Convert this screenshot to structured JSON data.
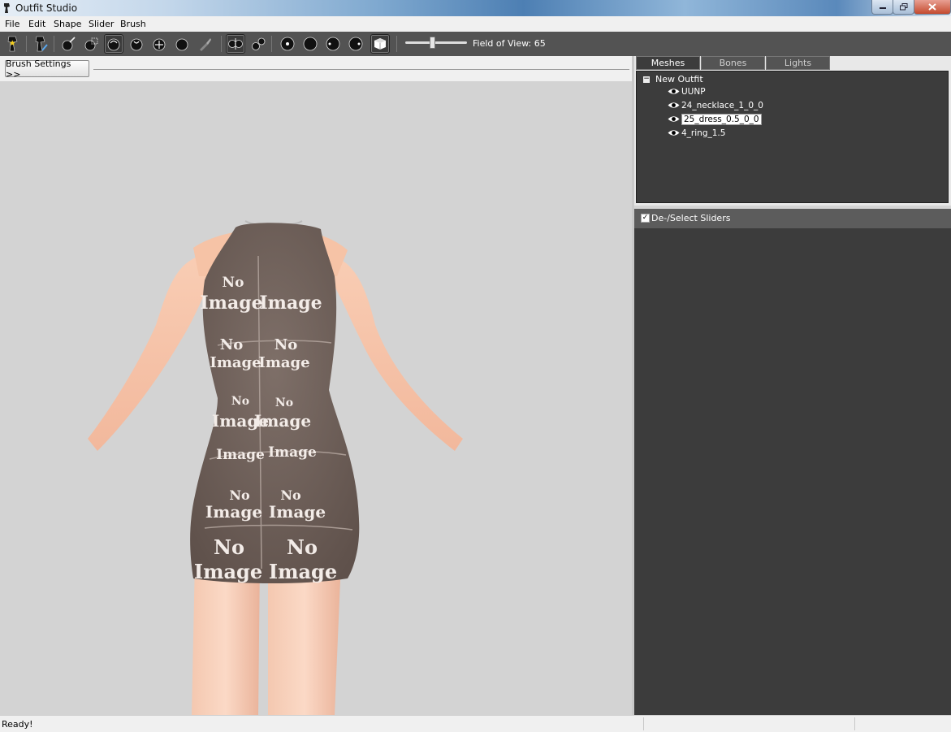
{
  "window": {
    "title": "Outfit Studio"
  },
  "menu": [
    "File",
    "Edit",
    "Shape",
    "Slider",
    "Brush"
  ],
  "toolbar": {
    "fov_label": "Field of View: 65",
    "fov_value": 65
  },
  "brush_settings": {
    "label": "Brush Settings >>"
  },
  "tabs": [
    {
      "label": "Meshes",
      "active": true
    },
    {
      "label": "Bones",
      "active": false
    },
    {
      "label": "Lights",
      "active": false
    }
  ],
  "mesh_tree": {
    "root": "New Outfit",
    "items": [
      "UUNP",
      "24_necklace_1_0_0",
      "25_dress_0.5_0_0",
      "4_ring_1.5"
    ],
    "selected_index": 2
  },
  "sliders": {
    "label": "De-/Select Sliders",
    "checked": true
  },
  "status": {
    "text": "Ready!"
  },
  "viewport": {
    "texture_text": [
      "No",
      "Image"
    ]
  },
  "colors": {
    "panel_dark": "#3c3c3c",
    "toolbar_bg": "#535353",
    "viewport_bg": "#d3d3d3",
    "dress": "#6f6059",
    "skin": "#f2c0a6"
  }
}
